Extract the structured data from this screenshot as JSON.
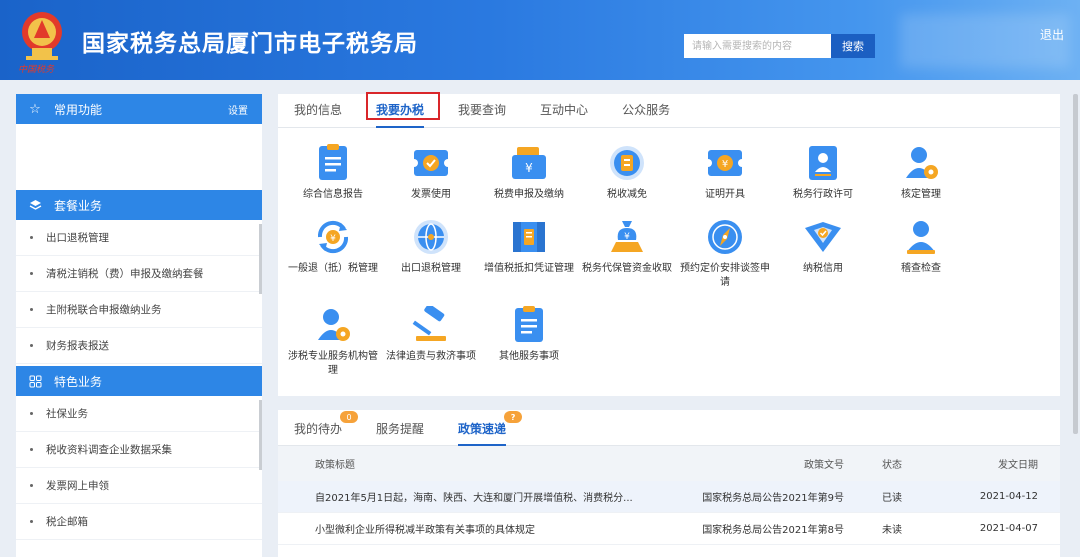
{
  "header": {
    "title": "国家税务总局厦门市电子税务局",
    "brand_sub": "中国税务",
    "search_placeholder": "请输入需要搜索的内容",
    "search_label": "搜索",
    "logout_label": "退出"
  },
  "sidebar": {
    "common": {
      "title": "常用功能",
      "setting": "设置"
    },
    "package": {
      "title": "套餐业务",
      "items": [
        "出口退税管理",
        "清税注销税（费）申报及缴纳套餐",
        "主附税联合申报缴纳业务",
        "财务报表报送"
      ]
    },
    "special": {
      "title": "特色业务",
      "items": [
        "社保业务",
        "税收资料调查企业数据采集",
        "发票网上申领",
        "税企邮箱"
      ]
    }
  },
  "tabs": [
    "我的信息",
    "我要办税",
    "我要查询",
    "互动中心",
    "公众服务"
  ],
  "active_tab": "我要办税",
  "services": [
    {
      "label": "综合信息报告",
      "icon": "document-icon"
    },
    {
      "label": "发票使用",
      "icon": "invoice-check-icon"
    },
    {
      "label": "税费申报及缴纳",
      "icon": "wallet-icon"
    },
    {
      "label": "税收减免",
      "icon": "coin-icon"
    },
    {
      "label": "证明开具",
      "icon": "certificate-icon"
    },
    {
      "label": "税务行政许可",
      "icon": "id-card-icon"
    },
    {
      "label": "核定管理",
      "icon": "user-gear-icon"
    },
    {
      "label": "一般退（抵）税管理",
      "icon": "refund-icon"
    },
    {
      "label": "出口退税管理",
      "icon": "globe-icon"
    },
    {
      "label": "增值税抵扣凭证管理",
      "icon": "voucher-icon"
    },
    {
      "label": "税务代保管资金收取",
      "icon": "money-bag-icon"
    },
    {
      "label": "预约定价安排谈签申请",
      "icon": "compass-icon"
    },
    {
      "label": "纳税信用",
      "icon": "shield-heart-icon"
    },
    {
      "label": "稽查检查",
      "icon": "inspector-icon"
    },
    {
      "label": "涉税专业服务机构管理",
      "icon": "agency-icon"
    },
    {
      "label": "法律追责与救济事项",
      "icon": "gavel-icon"
    },
    {
      "label": "其他服务事项",
      "icon": "list-icon"
    }
  ],
  "bottom": {
    "tabs": [
      {
        "label": "我的待办",
        "badge": "0"
      },
      {
        "label": "服务提醒",
        "badge": ""
      },
      {
        "label": "政策速递",
        "badge": "?"
      }
    ],
    "columns": [
      "政策标题",
      "政策文号",
      "状态",
      "发文日期"
    ],
    "rows": [
      {
        "title": "自2021年5月1日起，海南、陕西、大连和厦门开展增值税、消费税分...",
        "doc": "国家税务总局公告2021年第9号",
        "status": "已读",
        "date": "2021-04-12"
      },
      {
        "title": "小型微利企业所得税减半政策有关事项的具体规定",
        "doc": "国家税务总局公告2021年第8号",
        "status": "未读",
        "date": "2021-04-07"
      }
    ]
  },
  "colors": {
    "primary": "#2d86e6",
    "icon_blue": "#3a8ff0",
    "icon_orange": "#f5a623",
    "highlight_red": "#d9262a"
  }
}
